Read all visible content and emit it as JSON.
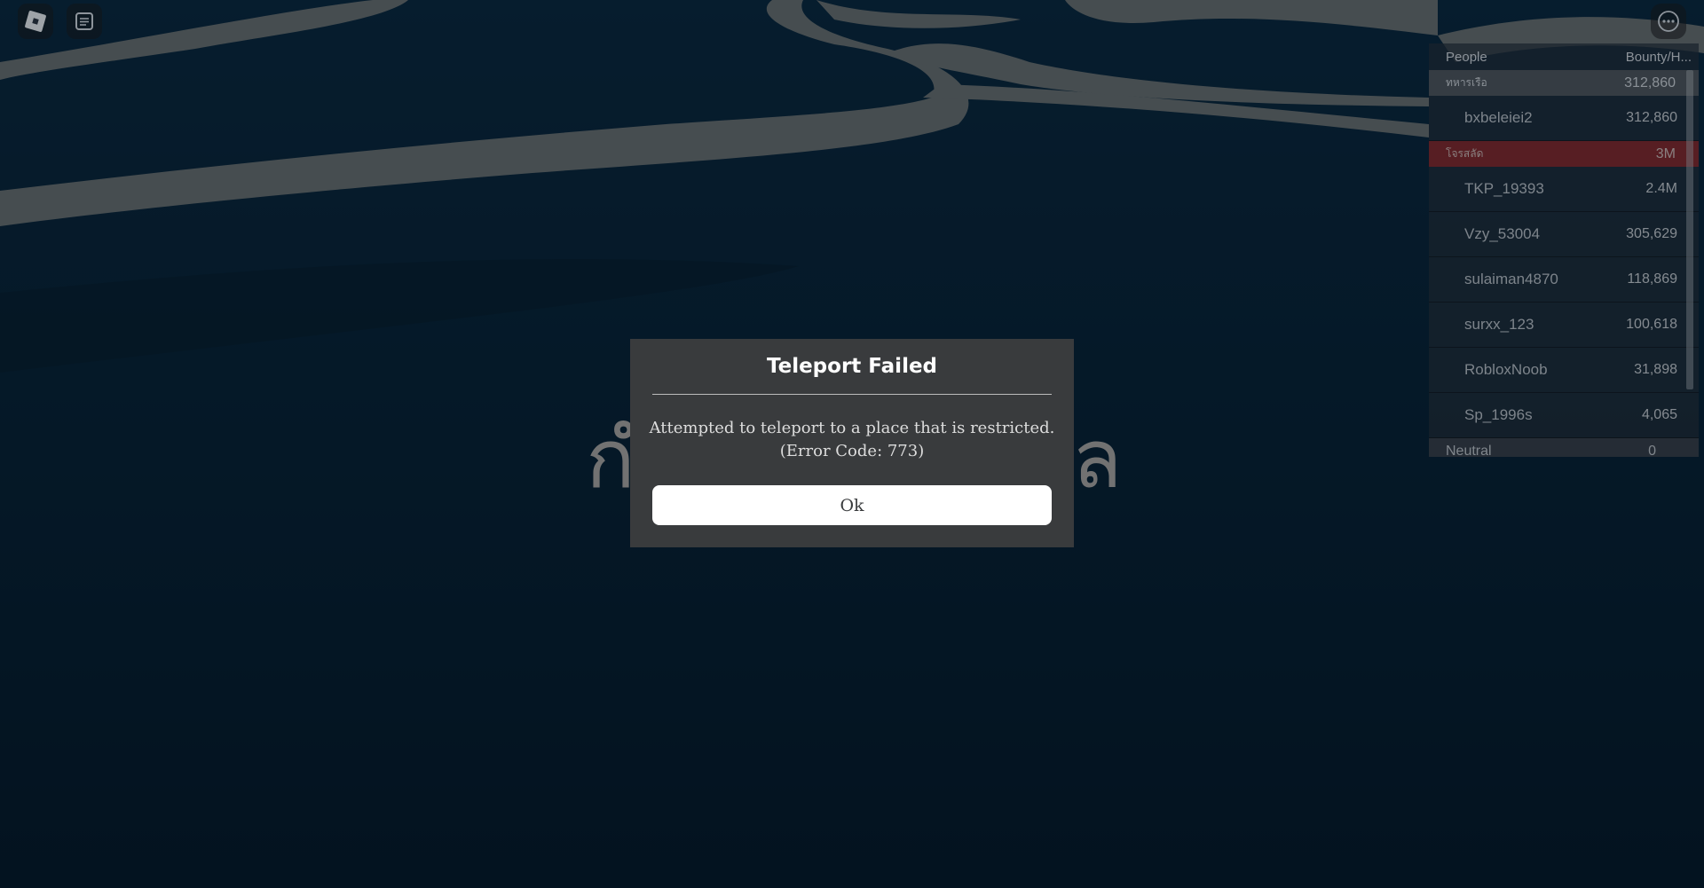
{
  "scene": {
    "loading_text_left": "กำ",
    "loading_text_right": "ล"
  },
  "topbar": {
    "roblox_menu_icon": "roblox-logo-icon",
    "chat_icon": "chat-icon",
    "more_icon": "more-options-icon"
  },
  "leaderboard": {
    "header": {
      "people": "People",
      "stat": "Bounty/H..."
    },
    "teams": [
      {
        "name": "ทหารเรือ",
        "value": "312,860",
        "color": "#3c4248",
        "players": [
          {
            "name": "bxbeleiei2",
            "value": "312,860"
          }
        ]
      },
      {
        "name": "โจรสลัด",
        "value": "3M",
        "color": "#641e22",
        "players": [
          {
            "name": "TKP_19393",
            "value": "2.4M"
          },
          {
            "name": "Vzy_53004",
            "value": "305,629"
          },
          {
            "name": "sulaiman4870",
            "value": "118,869"
          },
          {
            "name": "surxx_123",
            "value": "100,618"
          },
          {
            "name": "RobloxNoob",
            "value": "31,898"
          },
          {
            "name": "Sp_1996s",
            "value": "4,065"
          }
        ]
      }
    ],
    "neutral": {
      "name": "Neutral",
      "value": "0"
    }
  },
  "dialog": {
    "title": "Teleport Failed",
    "message_line1": "Attempted to teleport to a place that is restricted.",
    "message_line2": "(Error Code: 773)",
    "ok_label": "Ok"
  }
}
